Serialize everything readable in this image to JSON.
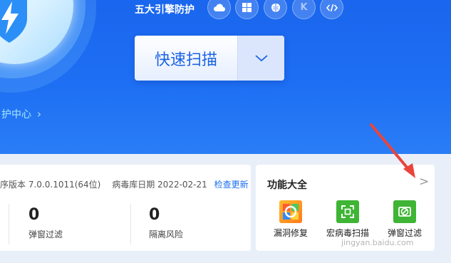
{
  "hero": {
    "engine_title": "五大引擎防护",
    "engines": [
      "cloud-icon",
      "windows-icon",
      "brain-icon",
      "kernel-k-icon",
      "code-icon"
    ],
    "scan_label": "快速扫描",
    "protect_center": "护中心"
  },
  "info": {
    "version_label": "序版本",
    "version_value": "7.0.0.1011(64位)",
    "db_label": "病毒库日期",
    "db_value": "2022-02-21",
    "update_link": "检查更新",
    "stats": [
      {
        "value": "0",
        "label": "弹窗过滤"
      },
      {
        "value": "0",
        "label": "隔离风险"
      }
    ]
  },
  "functions": {
    "title": "功能大全",
    "more": ">",
    "tools": [
      {
        "label": "漏洞修复"
      },
      {
        "label": "宏病毒扫描"
      },
      {
        "label": "弹窗过滤"
      }
    ]
  },
  "colors": {
    "brand_blue": "#1e6ff3",
    "link_blue": "#1a6ef0",
    "annotation_red": "#e8453c",
    "tool_green": "#3fb535"
  },
  "watermark": "jingyan.baidu.com"
}
